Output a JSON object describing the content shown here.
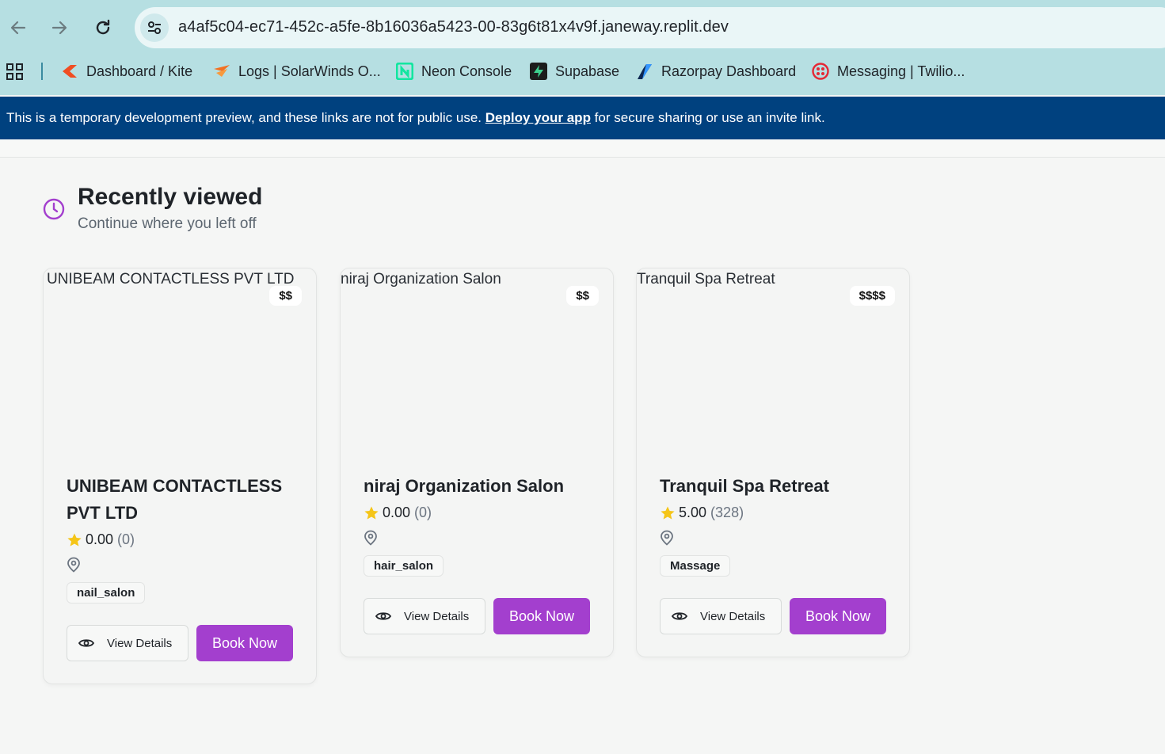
{
  "browser": {
    "url": "a4af5c04-ec71-452c-a5fe-8b16036a5423-00-83g6t81x4v9f.janeway.replit.dev",
    "bookmarks": [
      {
        "label": "Dashboard / Kite",
        "icon": "kite-icon"
      },
      {
        "label": "Logs | SolarWinds O...",
        "icon": "solarwinds-icon"
      },
      {
        "label": "Neon Console",
        "icon": "neon-icon"
      },
      {
        "label": "Supabase",
        "icon": "supabase-icon"
      },
      {
        "label": "Razorpay Dashboard",
        "icon": "razorpay-icon"
      },
      {
        "label": "Messaging | Twilio...",
        "icon": "twilio-icon"
      }
    ]
  },
  "banner": {
    "text_before": "This is a temporary development preview, and these links are not for public use. ",
    "link": "Deploy your app",
    "text_after": " for secure sharing or use an invite link."
  },
  "section": {
    "title": "Recently viewed",
    "subtitle": "Continue where you left off"
  },
  "cards": [
    {
      "image_alt": "UNIBEAM CONTACTLESS PVT LTD",
      "price": "$$",
      "title": "UNIBEAM CONTACTLESS PVT LTD",
      "rating": "0.00",
      "count": "(0)",
      "tag": "nail_salon",
      "view_label": "View Details",
      "book_label": "Book Now"
    },
    {
      "image_alt": "niraj Organization Salon",
      "price": "$$",
      "title": "niraj Organization Salon",
      "rating": "0.00",
      "count": "(0)",
      "tag": "hair_salon",
      "view_label": "View Details",
      "book_label": "Book Now"
    },
    {
      "image_alt": "Tranquil Spa Retreat",
      "price": "$$$$",
      "title": "Tranquil Spa Retreat",
      "rating": "5.00",
      "count": "(328)",
      "tag": "Massage",
      "view_label": "View Details",
      "book_label": "Book Now"
    }
  ],
  "colors": {
    "accent": "#a33fce",
    "banner": "#00417f",
    "star": "#f5c518",
    "chrome": "#b6dfe2"
  }
}
